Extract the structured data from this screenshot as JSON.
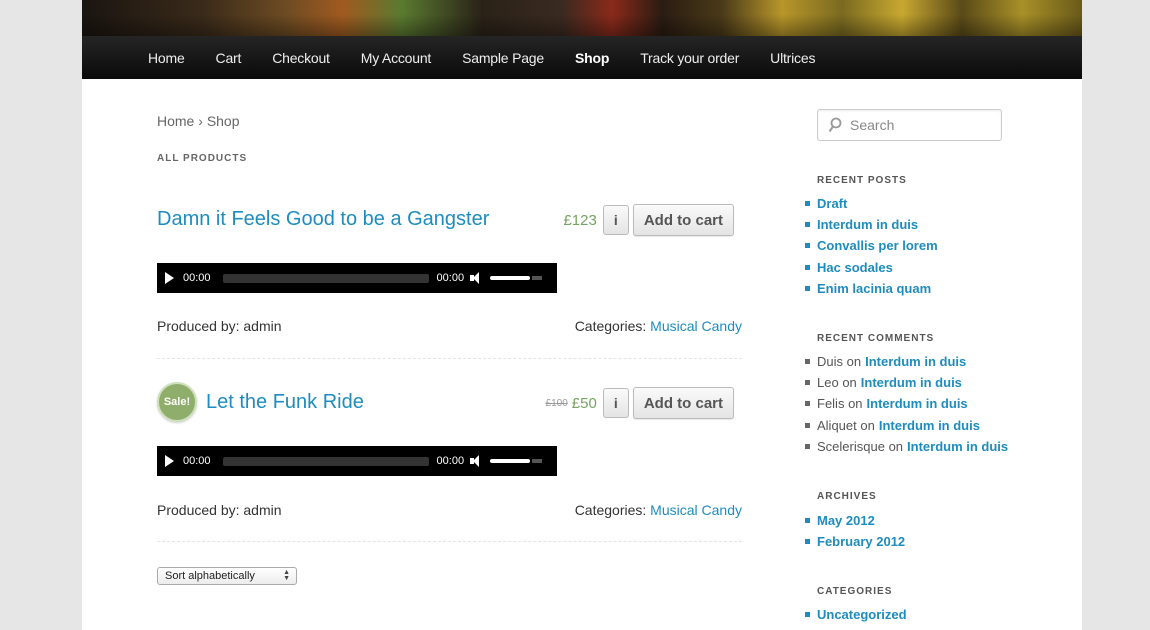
{
  "nav": {
    "items": [
      "Home",
      "Cart",
      "Checkout",
      "My Account",
      "Sample Page",
      "Shop",
      "Track your order",
      "Ultrices"
    ],
    "active": "Shop"
  },
  "breadcrumb": {
    "home": "Home",
    "separator": "›",
    "current": "Shop"
  },
  "page_heading": "ALL PRODUCTS",
  "products": [
    {
      "title": "Damn it Feels Good to be a Gangster",
      "price": "£123",
      "old_price": "",
      "sale_badge": "",
      "info_button": "i",
      "add_to_cart": "Add to cart",
      "player": {
        "current": "00:00",
        "duration": "00:00"
      },
      "produced_label": "Produced by:",
      "produced_by": "admin",
      "categories_label": "Categories:",
      "category": "Musical Candy"
    },
    {
      "title": "Let the Funk Ride",
      "price": "£50",
      "old_price": "£100",
      "sale_badge": "Sale!",
      "info_button": "i",
      "add_to_cart": "Add to cart",
      "player": {
        "current": "00:00",
        "duration": "00:00"
      },
      "produced_label": "Produced by:",
      "produced_by": "admin",
      "categories_label": "Categories:",
      "category": "Musical Candy"
    }
  ],
  "sort": {
    "selected": "Sort alphabetically"
  },
  "search": {
    "placeholder": "Search"
  },
  "sidebar": {
    "recent_posts": {
      "title": "RECENT POSTS",
      "items": [
        "Draft",
        "Interdum in duis",
        "Convallis per lorem",
        "Hac sodales",
        "Enim lacinia quam"
      ]
    },
    "recent_comments": {
      "title": "RECENT COMMENTS",
      "items": [
        {
          "author": "Duis",
          "on": "on",
          "post": "Interdum in duis"
        },
        {
          "author": "Leo",
          "on": "on",
          "post": "Interdum in duis"
        },
        {
          "author": "Felis",
          "on": "on",
          "post": "Interdum in duis"
        },
        {
          "author": "Aliquet",
          "on": "on",
          "post": "Interdum in duis"
        },
        {
          "author": "Scelerisque",
          "on": "on",
          "post": "Interdum in duis"
        }
      ]
    },
    "archives": {
      "title": "ARCHIVES",
      "items": [
        "May 2012",
        "February 2012"
      ]
    },
    "categories": {
      "title": "CATEGORIES",
      "items": [
        "Uncategorized"
      ]
    }
  },
  "colors": {
    "link": "#1e8cbe",
    "price": "#77a464",
    "sale_badge": "#8fae6b",
    "nav_bg": "#111111"
  }
}
